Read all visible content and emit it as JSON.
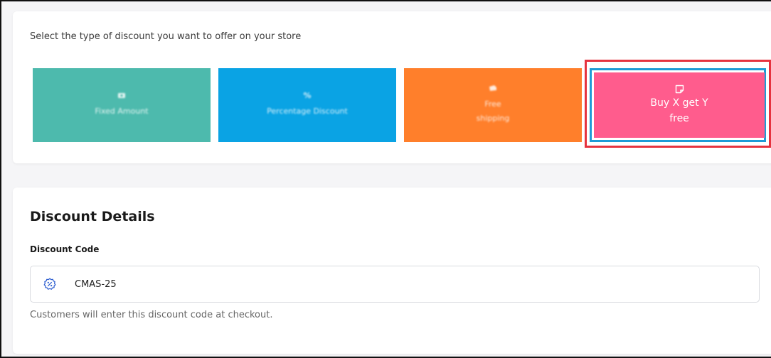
{
  "discount_type": {
    "instruction": "Select the type of discount you want to offer on your store",
    "options": [
      {
        "icon": "money-icon",
        "label": "Fixed Amount",
        "color": "#4dbaad"
      },
      {
        "icon": "percent-icon",
        "label": "Percentage Discount",
        "color": "#0aa3e4"
      },
      {
        "icon": "truck-icon",
        "label_line1": "Free",
        "label_line2": "shipping",
        "color": "#ff7f2b"
      },
      {
        "icon": "note-icon",
        "label_line1": "Buy X get Y",
        "label_line2": "free",
        "color": "#ff5c8d"
      }
    ],
    "highlight_colors": {
      "outer": "#e6333f",
      "inner": "#1e9bd6"
    }
  },
  "discount_details": {
    "title": "Discount Details",
    "code_label": "Discount Code",
    "code_value": "CMAS-25",
    "code_icon": "percent-badge-icon",
    "helper_text": "Customers will enter this discount code at checkout."
  }
}
